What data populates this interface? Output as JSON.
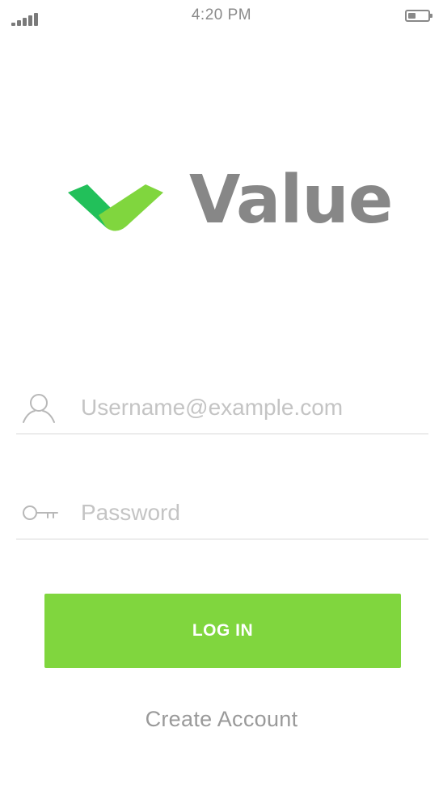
{
  "status_bar": {
    "time": "4:20 PM",
    "signal_icon": "cellular-signal-icon",
    "battery_icon": "battery-icon",
    "battery_level": 0.4
  },
  "logo": {
    "icon": "checkmark-logo-icon",
    "wordmark": "Value",
    "colors": {
      "dark_green": "#22c05a",
      "light_green": "#80d63e",
      "wordmark_gray": "#878787"
    }
  },
  "login_form": {
    "username": {
      "icon": "user-icon",
      "value": "",
      "placeholder": "Username@example.com"
    },
    "password": {
      "icon": "key-icon",
      "value": "",
      "placeholder": "Password"
    },
    "login_button": {
      "label": "LOG IN",
      "color": "#80d63e"
    },
    "create_account_label": "Create Account"
  }
}
